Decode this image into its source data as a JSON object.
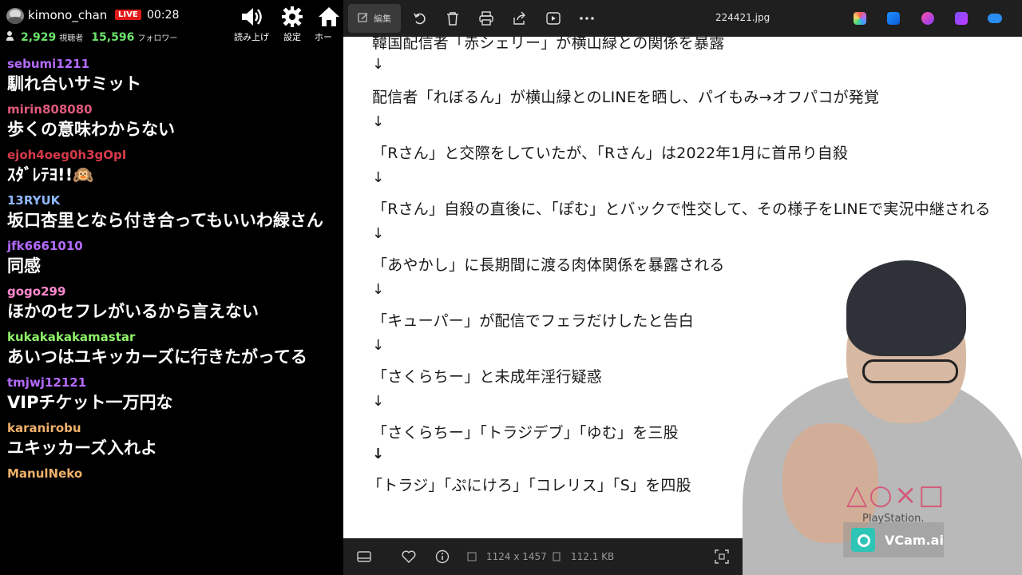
{
  "chat_header": {
    "channel_name": "kimono_chan",
    "live_badge": "LIVE",
    "elapsed": "00:28",
    "viewers_count": "2,929",
    "viewers_label": "視聴者",
    "followers_count": "15,596",
    "followers_label": "フォロワー",
    "buttons": [
      {
        "label": "読み上げ",
        "icon": "speaker-icon"
      },
      {
        "label": "設定",
        "icon": "gear-icon"
      },
      {
        "label": "ホー",
        "icon": "home-icon"
      }
    ]
  },
  "chat": {
    "messages": [
      {
        "user": "sebumi1211",
        "color": "#b36bff",
        "text": "馴れ合いサミット"
      },
      {
        "user": "mirin808080",
        "color": "#e05a7a",
        "text": "歩くの意味わからない"
      },
      {
        "user": "ejoh4oeg0h3gOpI",
        "color": "#d63a4a",
        "text": "ｽﾀﾞﾚﾃﾖ!!🙉"
      },
      {
        "user": "13RYUK",
        "color": "#8fb8ff",
        "text": "坂口杏里となら付き合ってもいいわ緑さん"
      },
      {
        "user": "jfk6661010",
        "color": "#b36bff",
        "text": "同感"
      },
      {
        "user": "gogo299",
        "color": "#ff8ad0",
        "text": "ほかのセフレがいるから言えない"
      },
      {
        "user": "kukakakakamastar",
        "color": "#8ff26a",
        "text": "あいつはユキッカーズに行きたがってる"
      },
      {
        "user": "tmjwj12121",
        "color": "#b36bff",
        "text": "VIPチケット一万円な"
      },
      {
        "user": "karanirobu",
        "color": "#f0b16a",
        "text": "ユキッカーズ入れよ"
      },
      {
        "user": "ManulNeko",
        "color": "#f0b16a",
        "text": ""
      }
    ]
  },
  "viewer": {
    "toolbar": {
      "edit_label": "編集",
      "filename": "224421.jpg"
    },
    "document": {
      "lines": [
        "韓国配信者「赤シェリー」が横山緑との関係を暴露",
        "↓",
        "配信者「れぼるん」が横山緑とのLINEを晒し、パイもみ→オフパコが発覚",
        "↓",
        "「Rさん」と交際をしていたが、「Rさん」は2022年1月に首吊り自殺",
        "↓",
        "「Rさん」自殺の直後に、「ぽむ」とバックで性交して、その様子をLINEで実況中継される",
        "↓",
        "「あやかし」に長期間に渡る肉体関係を暴露される",
        "↓",
        "「キューパー」が配信でフェラだけしたと告白",
        "↓",
        "「さくらちー」と未成年淫行疑惑",
        "↓",
        "「さくらちー」「トラジデブ」「ゆむ」を三股",
        "↓",
        "「トラジ」「ぷにけろ」「コレリス」「S」を四股"
      ]
    },
    "statusbar": {
      "dimensions": "1124 x 1457",
      "filesize": "112.1 KB"
    }
  },
  "webcam": {
    "shirt_logo": "△○×□",
    "shirt_brand": "PlayStation.",
    "watermark": "VCam.ai"
  }
}
